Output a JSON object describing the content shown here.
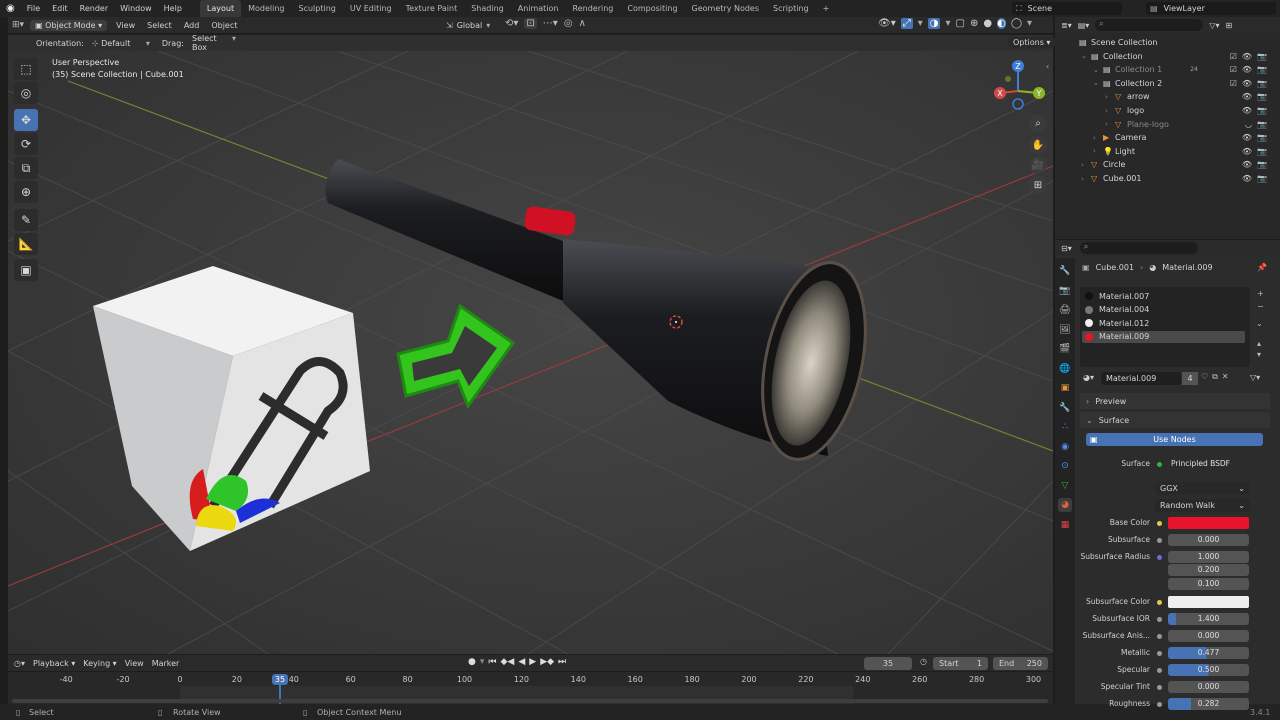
{
  "menubar": {
    "items": [
      "File",
      "Edit",
      "Render",
      "Window",
      "Help"
    ],
    "workspaces": [
      "Layout",
      "Modeling",
      "Sculpting",
      "UV Editing",
      "Texture Paint",
      "Shading",
      "Animation",
      "Rendering",
      "Compositing",
      "Geometry Nodes",
      "Scripting"
    ],
    "active_workspace": "Layout",
    "add_tab": "+",
    "scene": "Scene",
    "view_layer": "ViewLayer"
  },
  "viewport_header": {
    "mode": "Object Mode",
    "menus": [
      "View",
      "Select",
      "Add",
      "Object"
    ],
    "transform": "Global",
    "options": "Options"
  },
  "tool_settings": {
    "orientation_label": "Orientation:",
    "orientation_value": "Default",
    "drag_label": "Drag:",
    "drag_value": "Select Box"
  },
  "viewport": {
    "perspective": "User Perspective",
    "collection_info": "(35) Scene Collection | Cube.001"
  },
  "gizmo": {
    "x": "X",
    "y": "Y",
    "z": "Z"
  },
  "outliner": {
    "rows": [
      {
        "label": "Scene Collection",
        "indent": 0,
        "icon": "collection"
      },
      {
        "label": "Collection",
        "indent": 1,
        "icon": "collection"
      },
      {
        "label": "Collection 1",
        "indent": 2,
        "icon": "collection",
        "dim": true,
        "badge": "24"
      },
      {
        "label": "Collection 2",
        "indent": 2,
        "icon": "collection"
      },
      {
        "label": "arrow",
        "indent": 3,
        "icon": "mesh"
      },
      {
        "label": "logo",
        "indent": 3,
        "icon": "mesh"
      },
      {
        "label": "Plane-logo",
        "indent": 3,
        "icon": "mesh",
        "dim": true
      },
      {
        "label": "Camera",
        "indent": 2,
        "icon": "camera"
      },
      {
        "label": "Light",
        "indent": 2,
        "icon": "light"
      },
      {
        "label": "Circle",
        "indent": 1,
        "icon": "mesh"
      },
      {
        "label": "Cube.001",
        "indent": 1,
        "icon": "mesh"
      }
    ]
  },
  "properties": {
    "object": "Cube.001",
    "material": "Material.009",
    "slots": [
      "Material.007",
      "Material.004",
      "Material.012",
      "Material.009"
    ],
    "active_slot": "Material.009",
    "material_field": "Material.009",
    "user_count": "4",
    "preview_panel": "Preview",
    "surface_panel": "Surface",
    "use_nodes": "Use Nodes",
    "surface_label": "Surface",
    "surface_value": "Principled BSDF",
    "distribution": "GGX",
    "subsurface_method": "Random Walk",
    "fields": [
      {
        "label": "Base Color",
        "value": "",
        "color": "#e8142c"
      },
      {
        "label": "Subsurface",
        "value": "0.000"
      },
      {
        "label": "Subsurface Radius",
        "value": "1.000"
      },
      {
        "label": "",
        "value": "0.200"
      },
      {
        "label": "",
        "value": "0.100"
      },
      {
        "label": "Subsurface Color",
        "value": "",
        "color": "#eeeeee"
      },
      {
        "label": "Subsurface IOR",
        "value": "1.400",
        "fill": 0.1
      },
      {
        "label": "Subsurface Anis...",
        "value": "0.000"
      },
      {
        "label": "Metallic",
        "value": "0.477",
        "fill": 0.477
      },
      {
        "label": "Specular",
        "value": "0.500",
        "fill": 0.5
      },
      {
        "label": "Specular Tint",
        "value": "0.000"
      },
      {
        "label": "Roughness",
        "value": "0.282",
        "fill": 0.282
      }
    ]
  },
  "timeline": {
    "menus": [
      "Playback",
      "Keying",
      "View",
      "Marker"
    ],
    "current_frame": "35",
    "start_label": "Start",
    "start": "1",
    "end_label": "End",
    "end": "250",
    "ticks": [
      "-40",
      "-20",
      "0",
      "20",
      "40",
      "60",
      "80",
      "100",
      "120",
      "140",
      "160",
      "180",
      "200",
      "220",
      "240",
      "260",
      "280",
      "300"
    ],
    "playhead": "35"
  },
  "statusbar": {
    "select": "Select",
    "rotate": "Rotate View",
    "context": "Object Context Menu",
    "version": "3.4.1"
  },
  "colors": {
    "accent": "#4772b3",
    "base_color": "#e8142c"
  }
}
